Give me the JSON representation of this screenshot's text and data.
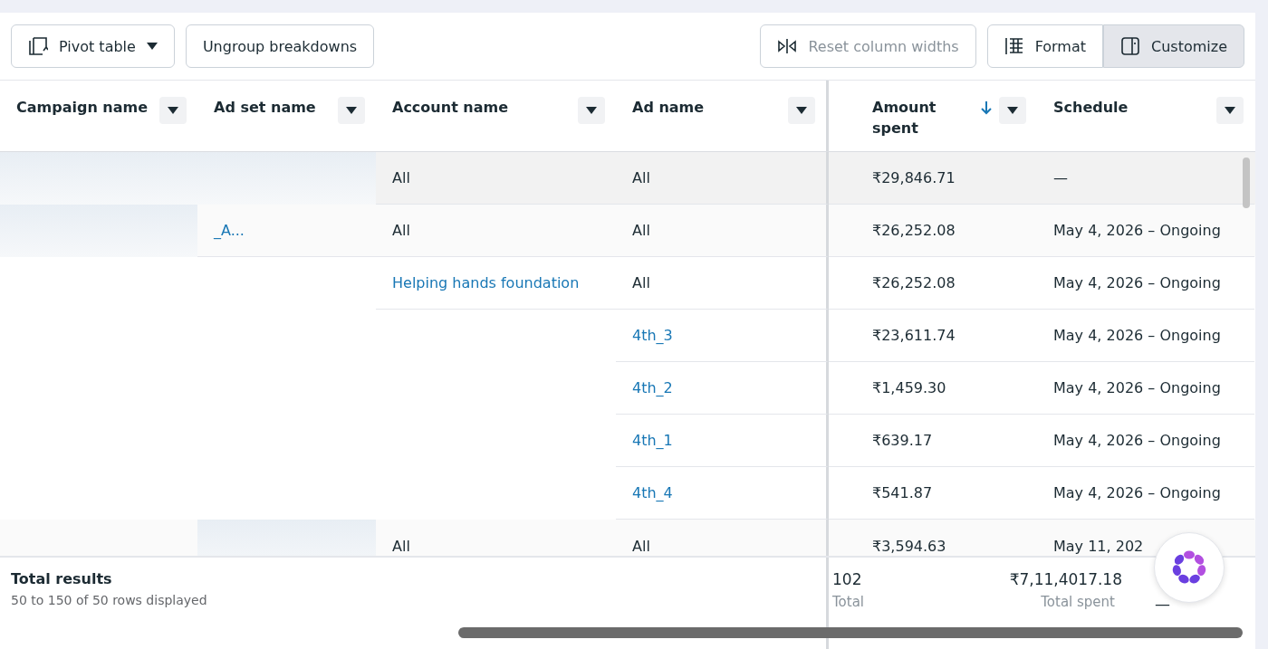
{
  "toolbar": {
    "left": [
      {
        "kind": "pivot",
        "label": "Pivot table"
      },
      {
        "kind": "plain",
        "label": "Ungroup breakdowns"
      }
    ],
    "right": [
      {
        "kind": "reset",
        "label": "Reset column widths",
        "disabled": true,
        "selected": false
      },
      {
        "kind": "format",
        "label": "Format",
        "disabled": false,
        "selected": false
      },
      {
        "kind": "customize",
        "label": "Customize",
        "disabled": false,
        "selected": true
      }
    ]
  },
  "table": {
    "columns": [
      {
        "label": "Campaign name",
        "sorted": false
      },
      {
        "label": "Ad set name",
        "sorted": false
      },
      {
        "label": "Account name",
        "sorted": false
      },
      {
        "label": "Ad name",
        "sorted": false
      },
      {
        "label": "Amount spent",
        "sorted": true
      },
      {
        "label": "Schedule",
        "sorted": false
      }
    ],
    "rows": [
      {
        "kind": "summary",
        "cells": [
          {
            "kind": "redacted"
          },
          {
            "kind": "redacted"
          },
          {
            "kind": "text",
            "text": "All"
          },
          {
            "kind": "text",
            "text": "All"
          },
          {
            "kind": "text",
            "text": "₹29,846.71"
          },
          {
            "kind": "text",
            "text": "—"
          }
        ]
      },
      {
        "kind": "group",
        "cells": [
          {
            "kind": "redacted"
          },
          {
            "kind": "link",
            "text": "_A..."
          },
          {
            "kind": "text",
            "text": "All"
          },
          {
            "kind": "text",
            "text": "All"
          },
          {
            "kind": "text",
            "text": "₹26,252.08"
          },
          {
            "kind": "text",
            "text": "May 4, 2026 – Ongoing"
          }
        ]
      },
      {
        "kind": "data",
        "cells": [
          {
            "kind": "empty"
          },
          {
            "kind": "empty"
          },
          {
            "kind": "link",
            "text": "Helping hands foundation"
          },
          {
            "kind": "text",
            "text": "All"
          },
          {
            "kind": "text",
            "text": "₹26,252.08"
          },
          {
            "kind": "text",
            "text": "May 4, 2026 – Ongoing"
          }
        ]
      },
      {
        "kind": "data",
        "cells": [
          {
            "kind": "empty"
          },
          {
            "kind": "empty"
          },
          {
            "kind": "empty"
          },
          {
            "kind": "link",
            "text": "4th_3"
          },
          {
            "kind": "text",
            "text": "₹23,611.74"
          },
          {
            "kind": "text",
            "text": "May 4, 2026 – Ongoing"
          }
        ]
      },
      {
        "kind": "data",
        "cells": [
          {
            "kind": "empty"
          },
          {
            "kind": "empty"
          },
          {
            "kind": "empty"
          },
          {
            "kind": "link",
            "text": "4th_2"
          },
          {
            "kind": "text",
            "text": "₹1,459.30"
          },
          {
            "kind": "text",
            "text": "May 4, 2026 – Ongoing"
          }
        ]
      },
      {
        "kind": "data",
        "cells": [
          {
            "kind": "empty"
          },
          {
            "kind": "empty"
          },
          {
            "kind": "empty"
          },
          {
            "kind": "link",
            "text": "4th_1"
          },
          {
            "kind": "text",
            "text": "₹639.17"
          },
          {
            "kind": "text",
            "text": "May 4, 2026 – Ongoing"
          }
        ]
      },
      {
        "kind": "data",
        "cells": [
          {
            "kind": "empty"
          },
          {
            "kind": "empty"
          },
          {
            "kind": "empty"
          },
          {
            "kind": "link",
            "text": "4th_4"
          },
          {
            "kind": "text",
            "text": "₹541.87"
          },
          {
            "kind": "text",
            "text": "May 4, 2026 – Ongoing"
          }
        ]
      },
      {
        "kind": "group",
        "cells": [
          {
            "kind": "empty"
          },
          {
            "kind": "redacted"
          },
          {
            "kind": "text",
            "text": "All"
          },
          {
            "kind": "text",
            "text": "All"
          },
          {
            "kind": "text",
            "text": "₹3,594.63"
          },
          {
            "kind": "text",
            "text": "May 11, 202"
          }
        ]
      }
    ]
  },
  "footer": {
    "title": "Total results",
    "subtitle": "50 to 150 of 50 rows displayed",
    "results": {
      "value": "102",
      "label": "Total"
    },
    "spent": {
      "value": "₹7,11,4017.18",
      "label": "Total spent"
    },
    "schedule": "—"
  }
}
